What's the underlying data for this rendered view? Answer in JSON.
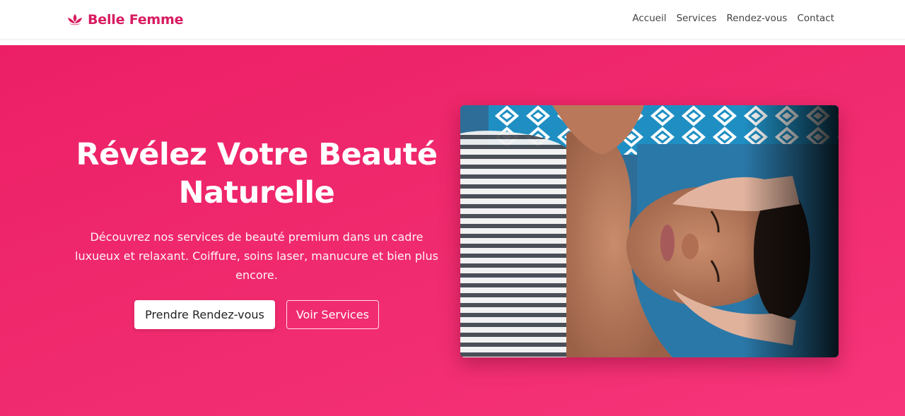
{
  "header": {
    "brand": {
      "name": "Belle Femme",
      "icon": "lotus-icon",
      "color": "#d81b60"
    },
    "nav": [
      {
        "label": "Accueil"
      },
      {
        "label": "Services"
      },
      {
        "label": "Rendez-vous"
      },
      {
        "label": "Contact"
      }
    ]
  },
  "hero": {
    "title_line1": "Révélez Votre Beauté",
    "title_line2": "Naturelle",
    "description": "Découvrez nos services de beauté premium dans un cadre luxueux et relaxant. Coiffure, soins laser, manucure et bien plus encore.",
    "primary_button": "Prendre Rendez-vous",
    "secondary_button": "Voir Services",
    "background_color": "#ef2a6f",
    "image": "spa-facial-massage-photo"
  }
}
